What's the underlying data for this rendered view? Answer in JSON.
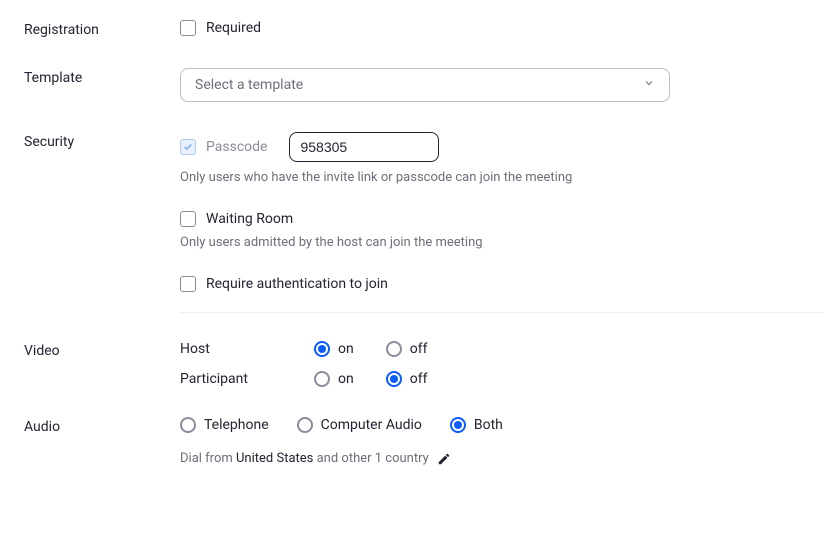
{
  "registration": {
    "label": "Registration",
    "required_label": "Required"
  },
  "template": {
    "label": "Template",
    "placeholder": "Select a template"
  },
  "security": {
    "label": "Security",
    "passcode_label": "Passcode",
    "passcode_value": "958305",
    "passcode_hint": "Only users who have the invite link or passcode can join the meeting",
    "waiting_room_label": "Waiting Room",
    "waiting_room_hint": "Only users admitted by the host can join the meeting",
    "require_auth_label": "Require authentication to join"
  },
  "video": {
    "label": "Video",
    "host_label": "Host",
    "participant_label": "Participant",
    "on_label": "on",
    "off_label": "off"
  },
  "audio": {
    "label": "Audio",
    "telephone_label": "Telephone",
    "computer_audio_label": "Computer Audio",
    "both_label": "Both",
    "dial_prefix": "Dial from ",
    "dial_country": "United States",
    "dial_suffix": " and other 1 country"
  }
}
